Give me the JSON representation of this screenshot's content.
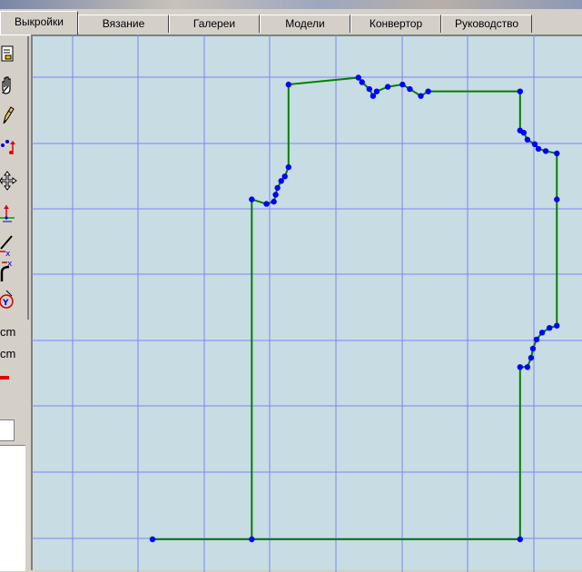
{
  "tabs": [
    {
      "label": "Выкройки",
      "active": true
    },
    {
      "label": "Вязание",
      "active": false
    },
    {
      "label": "Галереи",
      "active": false
    },
    {
      "label": "Модели",
      "active": false
    },
    {
      "label": "Конвертор",
      "active": false
    },
    {
      "label": "Руководство",
      "active": false
    }
  ],
  "tools": [
    {
      "name": "open-pattern-icon"
    },
    {
      "name": "pan-hand-icon"
    },
    {
      "name": "pencil-draw-icon"
    },
    {
      "name": "point-move-icon"
    },
    {
      "name": "move-arrows-icon"
    },
    {
      "name": "mirror-axis-icon"
    },
    {
      "name": "line-measure-icon"
    },
    {
      "name": "curve-measure-icon"
    },
    {
      "name": "rotate-xy-icon"
    }
  ],
  "units": {
    "unit_1": "cm",
    "unit_2": "cm"
  },
  "colors": {
    "canvas_bg": "#c8dce4",
    "grid": "#7a86f0",
    "outline": "#008000",
    "points": "#0000ff",
    "accent_red": "#e00000"
  },
  "pattern": {
    "outline_points": [
      [
        0,
        0
      ],
      [
        100,
        0
      ],
      [
        100,
        75
      ],
      [
        102,
        75
      ],
      [
        103,
        79
      ],
      [
        103.5,
        83
      ],
      [
        104.5,
        87
      ],
      [
        106,
        90
      ],
      [
        108,
        92
      ],
      [
        110,
        93
      ],
      [
        110,
        148
      ],
      [
        110,
        168
      ],
      [
        107,
        169
      ],
      [
        105,
        170
      ],
      [
        104,
        172
      ],
      [
        102,
        174
      ],
      [
        101,
        177
      ],
      [
        100,
        178
      ],
      [
        100,
        195
      ],
      [
        75,
        195
      ],
      [
        73,
        193
      ],
      [
        70,
        196
      ],
      [
        68,
        198
      ],
      [
        64,
        197
      ],
      [
        61,
        195
      ],
      [
        60,
        193
      ],
      [
        59,
        196
      ],
      [
        57,
        199
      ],
      [
        56,
        201
      ],
      [
        37,
        198
      ],
      [
        37,
        162
      ],
      [
        36,
        158
      ],
      [
        35,
        156
      ],
      [
        34,
        153
      ],
      [
        33.5,
        150
      ],
      [
        33,
        147
      ],
      [
        31,
        146
      ],
      [
        27,
        148
      ],
      [
        27,
        0
      ]
    ]
  }
}
